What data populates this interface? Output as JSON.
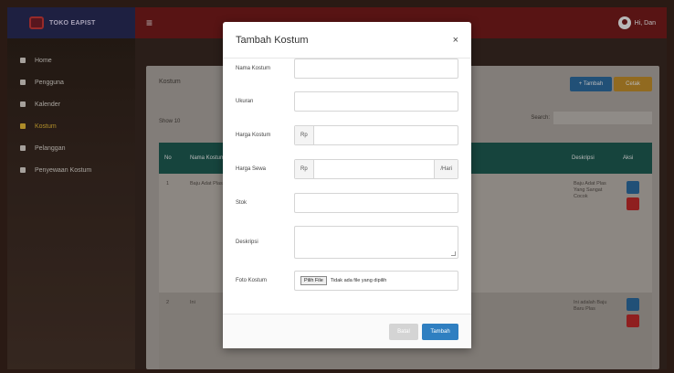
{
  "brand": {
    "name": "TOKO EAPIST"
  },
  "topbar": {
    "user": "Hi, Dan"
  },
  "sidebar": {
    "items": [
      {
        "label": "Home"
      },
      {
        "label": "Pengguna"
      },
      {
        "label": "Kalender"
      },
      {
        "label": "Kostum"
      },
      {
        "label": "Pelanggan"
      },
      {
        "label": "Penyewaan Kostum"
      }
    ]
  },
  "content": {
    "title": "Kostum",
    "add_label": "+ Tambah",
    "print_label": "Cetak",
    "show_label": "Show",
    "show_value": "10",
    "search_label": "Search:",
    "columns": [
      "No",
      "Nama Kostum",
      "Deskripsi",
      "Aksi"
    ],
    "rows": [
      {
        "no": "1",
        "name": "Baju Adat Plas",
        "desc": "Baju Adat Plas Yang Sangat Cocok"
      },
      {
        "no": "2",
        "name": "Ini",
        "desc": "Ini adalah Baju Baru Plas"
      }
    ]
  },
  "modal": {
    "title": "Tambah Kostum",
    "close": "×",
    "fields": {
      "nama": {
        "label": "Nama Kostum",
        "value": ""
      },
      "ukuran": {
        "label": "Ukuran",
        "value": ""
      },
      "harga_kostum": {
        "label": "Harga Kostum",
        "prefix": "Rp"
      },
      "harga_sewa": {
        "label": "Harga Sewa",
        "prefix": "Rp",
        "suffix": "/Hari"
      },
      "stok": {
        "label": "Stok",
        "value": ""
      },
      "deskripsi": {
        "label": "Deskripsi",
        "value": ""
      },
      "foto": {
        "label": "Foto Kostum",
        "button": "Pilih File",
        "status": "Tidak ada file yang dipilih"
      }
    },
    "batal_label": "Batal",
    "tambah_label": "Tambah"
  },
  "colors": {
    "topbar": "#7b1d1d",
    "brand": "#2a2d5a",
    "table_header": "#1f5f55",
    "primary": "#2f7fc1"
  }
}
